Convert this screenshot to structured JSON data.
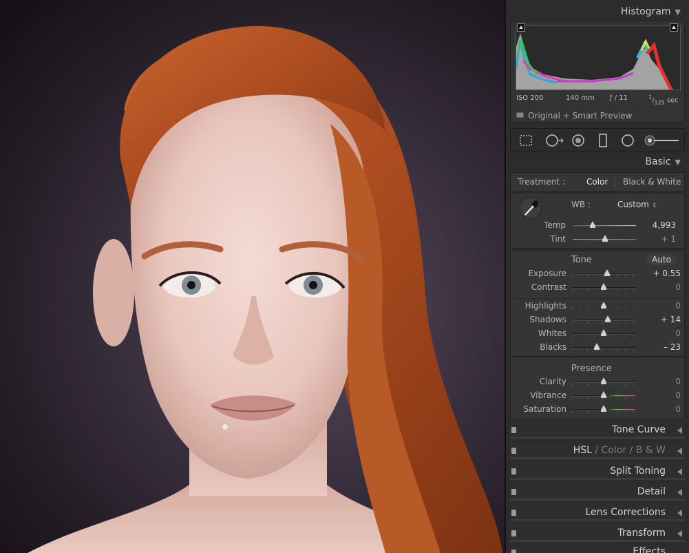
{
  "histogram": {
    "title": "Histogram",
    "iso": "ISO 200",
    "focal": "140 mm",
    "aperture": "ƒ / 11",
    "shutter_num": "1",
    "shutter_den": "125",
    "shutter_unit": "sec",
    "preview_label": "Original + Smart Preview"
  },
  "basic": {
    "title": "Basic",
    "treatment_label": "Treatment :",
    "treatment_color": "Color",
    "treatment_bw": "Black & White",
    "wb_label": "WB :",
    "wb_value": "Custom",
    "tone_label": "Tone",
    "auto_label": "Auto",
    "presence_label": "Presence",
    "sliders": {
      "temp": {
        "label": "Temp",
        "value": "4,993",
        "pos": 0.32
      },
      "tint": {
        "label": "Tint",
        "value": "+ 1",
        "pos": 0.51
      },
      "exposure": {
        "label": "Exposure",
        "value": "+ 0.55",
        "pos": 0.55
      },
      "contrast": {
        "label": "Contrast",
        "value": "0",
        "pos": 0.5
      },
      "highlights": {
        "label": "Highlights",
        "value": "0",
        "pos": 0.5
      },
      "shadows": {
        "label": "Shadows",
        "value": "+ 14",
        "pos": 0.57
      },
      "whites": {
        "label": "Whites",
        "value": "0",
        "pos": 0.5
      },
      "blacks": {
        "label": "Blacks",
        "value": "– 23",
        "pos": 0.39
      },
      "clarity": {
        "label": "Clarity",
        "value": "0",
        "pos": 0.5
      },
      "vibrance": {
        "label": "Vibrance",
        "value": "0",
        "pos": 0.5
      },
      "saturation": {
        "label": "Saturation",
        "value": "0",
        "pos": 0.5
      }
    }
  },
  "panels": {
    "tone_curve": "Tone Curve",
    "hsl": "HSL",
    "sep1": "/",
    "color": "Color",
    "sep2": "/",
    "bw": "B & W",
    "split_toning": "Split Toning",
    "detail": "Detail",
    "lens_corrections": "Lens Corrections",
    "transform": "Transform",
    "effects": "Effects"
  },
  "colors": {
    "panel_bg": "#2c2c2c",
    "section_bg": "#353535",
    "text": "#b9b9b9",
    "value_text": "#d8d8d8"
  }
}
